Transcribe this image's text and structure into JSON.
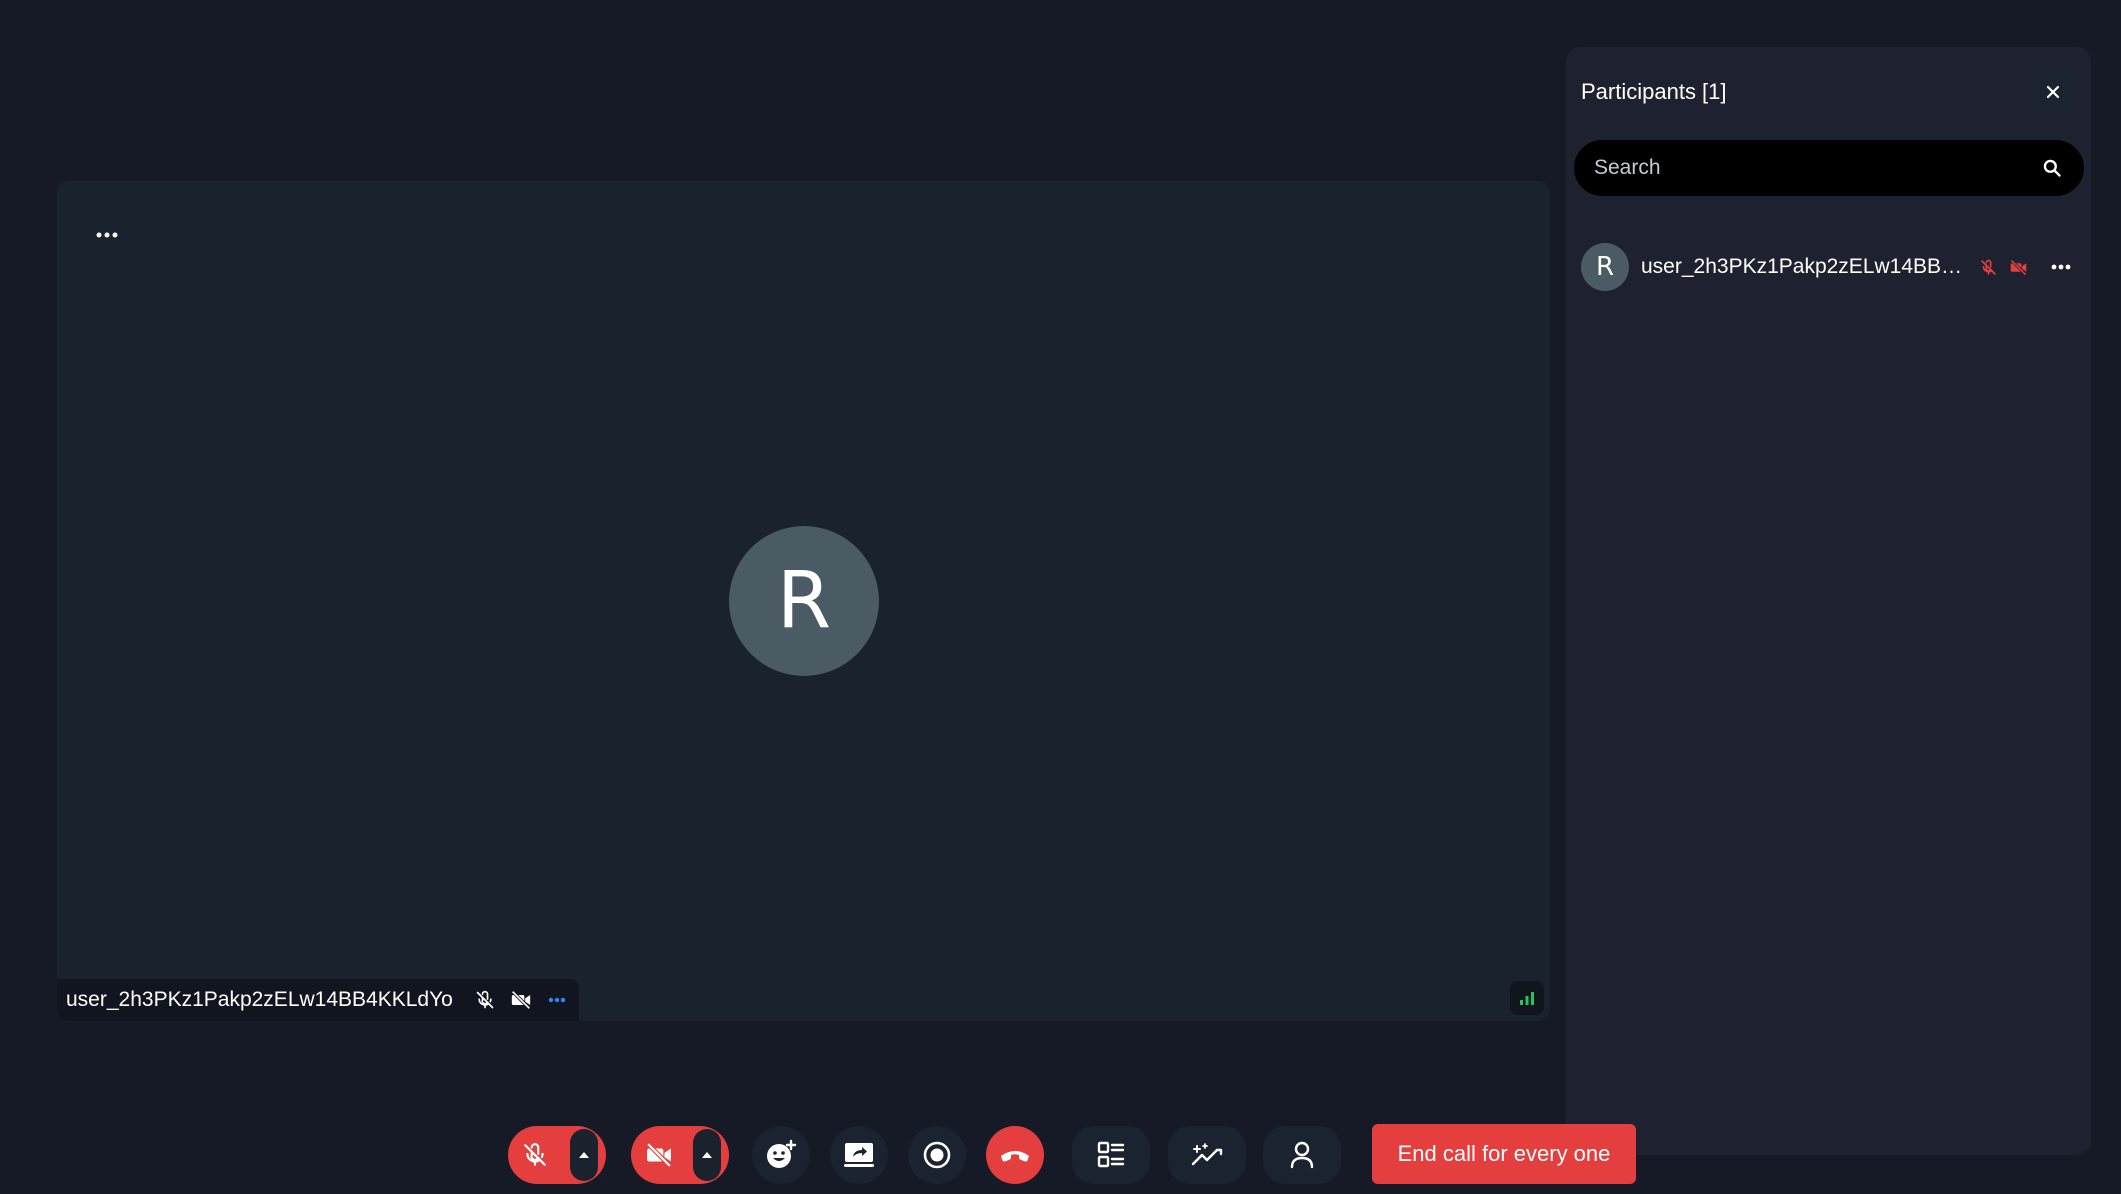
{
  "colors": {
    "background": "#161a26",
    "tile": "#1a222d",
    "panel": "#1e2230",
    "danger": "#e53e3e",
    "avatar": "#4b5b64",
    "signal": "#22c55e",
    "more_blue": "#3b82f6"
  },
  "video_tile": {
    "avatar_initial": "R",
    "display_name": "user_2h3PKz1Pakp2zELw14BB4KKLdYo",
    "icons": [
      "more-horizontal-icon",
      "mic-off-icon",
      "video-off-icon",
      "signal-bars-icon"
    ]
  },
  "participants_panel": {
    "title": "Participants [1]",
    "search_placeholder": "Search",
    "participants": [
      {
        "initial": "R",
        "name": "user_2h3PKz1Pakp2zELw14BB4K...",
        "mic_muted": true,
        "camera_off": true
      }
    ]
  },
  "controls": {
    "icons": [
      "mic-off-icon",
      "caret-up-icon",
      "video-off-icon",
      "caret-up-icon",
      "emoji-add-icon",
      "screen-share-icon",
      "record-icon",
      "hang-up-icon",
      "layout-list-icon",
      "sparkle-effects-icon",
      "person-icon"
    ],
    "end_call_all_label": "End call for every one"
  }
}
